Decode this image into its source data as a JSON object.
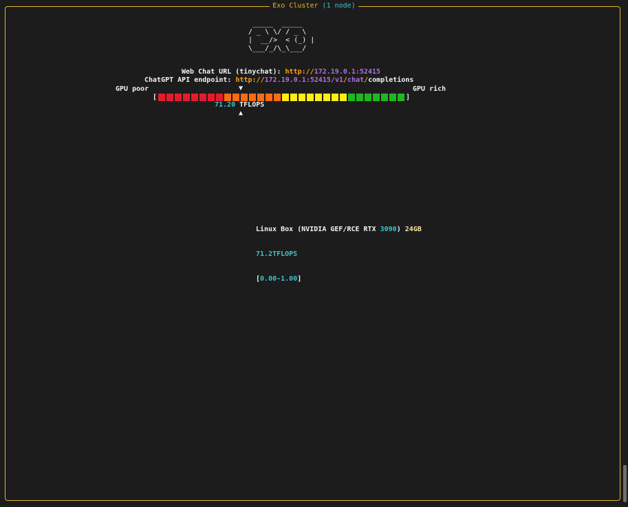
{
  "window": {
    "title": "Exo Cluster",
    "node_count": "(1 node)"
  },
  "logo_ascii": " _____  _____\n/ _ \\ \\/ / _ \\\n|  __/>  < (_) |\n\\___/_/\\_\\___/",
  "web_chat": {
    "label": "Web Chat URL (tinychat):",
    "scheme": "http://",
    "host": "172.19.0.1:52415"
  },
  "api": {
    "label": "ChatGPT API endpoint:",
    "scheme": "http://",
    "host": "172.19.0.1:52415",
    "path_parts": [
      "/",
      "v1",
      "/",
      "chat",
      "/",
      "completions"
    ]
  },
  "gpu_meter": {
    "left_label": "GPU poor",
    "right_label": "GPU rich",
    "open_bracket": "[",
    "close_bracket": "]",
    "marker_top": "▼",
    "marker_bottom": "▲",
    "tflops_value": "71.20",
    "tflops_unit": "TFLOPS",
    "cells": [
      "#e8192c",
      "#e8192c",
      "#e8192c",
      "#e8192c",
      "#e8192c",
      "#e8192c",
      "#e8192c",
      "#e8192c",
      "#ff6a10",
      "#ff6a10",
      "#ff6a10",
      "#ff6a10",
      "#ff6a10",
      "#ff6a10",
      "#ff6a10",
      "#ffee10",
      "#ffee10",
      "#ffee10",
      "#ffee10",
      "#ffee10",
      "#ffee10",
      "#ffee10",
      "#ffee10",
      "#1fb81f",
      "#1fb81f",
      "#1fb81f",
      "#1fb81f",
      "#1fb81f",
      "#1fb81f",
      "#1fb81f"
    ]
  },
  "node": {
    "name_prefix": "Linux Box (NVIDIA GEF/RCE RTX ",
    "model_number": "3090",
    "name_suffix": ")",
    "memory": "24GB",
    "tflops": "71.2TFLOPS",
    "range_open": "[",
    "range": "0.00-1.00",
    "range_close": "]"
  },
  "colors": {
    "border": "#e5b52c",
    "orange": "#ff9d1a",
    "purple": "#b06fe0",
    "cyan": "#3fc3c8"
  }
}
